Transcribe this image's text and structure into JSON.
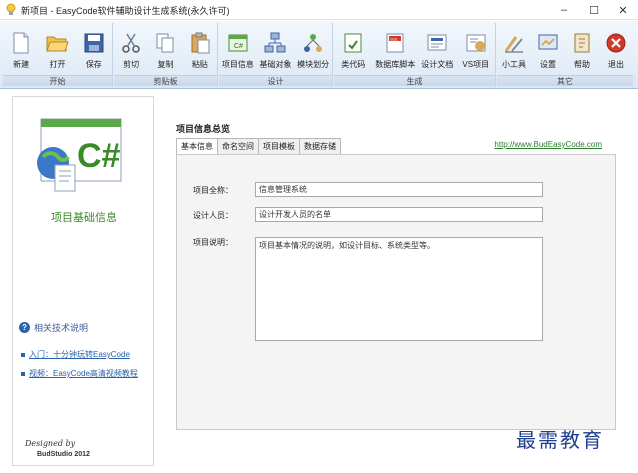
{
  "window": {
    "title": "新项目 - EasyCode软件辅助设计生成系统(永久许可)",
    "minimize": "–",
    "maximize": "☐",
    "close": "✕"
  },
  "ribbon": {
    "groups": [
      {
        "label": "开始",
        "items": [
          {
            "label": "新建",
            "icon": "new-file-icon"
          },
          {
            "label": "打开",
            "icon": "open-folder-icon"
          },
          {
            "label": "保存",
            "icon": "save-icon"
          }
        ]
      },
      {
        "label": "剪贴板",
        "items": [
          {
            "label": "剪切",
            "icon": "scissors-icon"
          },
          {
            "label": "复制",
            "icon": "copy-icon"
          },
          {
            "label": "粘贴",
            "icon": "paste-icon"
          }
        ]
      },
      {
        "label": "设计",
        "items": [
          {
            "label": "项目信息",
            "icon": "project-info-icon"
          },
          {
            "label": "基础对象",
            "icon": "base-object-icon"
          },
          {
            "label": "模块划分",
            "icon": "module-division-icon"
          }
        ]
      },
      {
        "label": "生成",
        "items": [
          {
            "label": "类代码",
            "icon": "class-code-icon"
          },
          {
            "label": "数据库脚本",
            "icon": "database-script-icon"
          },
          {
            "label": "设计文档",
            "icon": "design-doc-icon"
          },
          {
            "label": "VS项目",
            "icon": "vs-project-icon"
          }
        ]
      },
      {
        "label": "其它",
        "items": [
          {
            "label": "小工具",
            "icon": "tools-icon"
          },
          {
            "label": "设置",
            "icon": "settings-icon"
          },
          {
            "label": "帮助",
            "icon": "help-book-icon"
          },
          {
            "label": "退出",
            "icon": "exit-icon"
          }
        ]
      }
    ]
  },
  "left": {
    "title": "项目基础信息",
    "help": "相关技术说明",
    "links": [
      "入门：十分钟玩转EasyCode",
      "视频：EasyCode高清视频教程"
    ],
    "designed_by": "Designed by",
    "studio": "BudStudio 2012"
  },
  "content": {
    "heading": "项目信息总览",
    "tabs": [
      "基本信息",
      "命名空间",
      "项目模板",
      "数据存储"
    ],
    "active_tab": 0,
    "website": "http://www.BudEasyCode.com",
    "fields": {
      "fullname_label": "项目全称：",
      "fullname_value": "信息管理系统",
      "designer_label": "设计人员：",
      "designer_value": "设计开发人员的名单",
      "desc_label": "项目说明：",
      "desc_value": "项目基本情况的说明，如设计目标、系统类型等。"
    }
  },
  "watermark": "最需教育",
  "colors": {
    "accent": "#2b62a8",
    "green": "#3a8a2a",
    "exit_red": "#d03a2a"
  }
}
